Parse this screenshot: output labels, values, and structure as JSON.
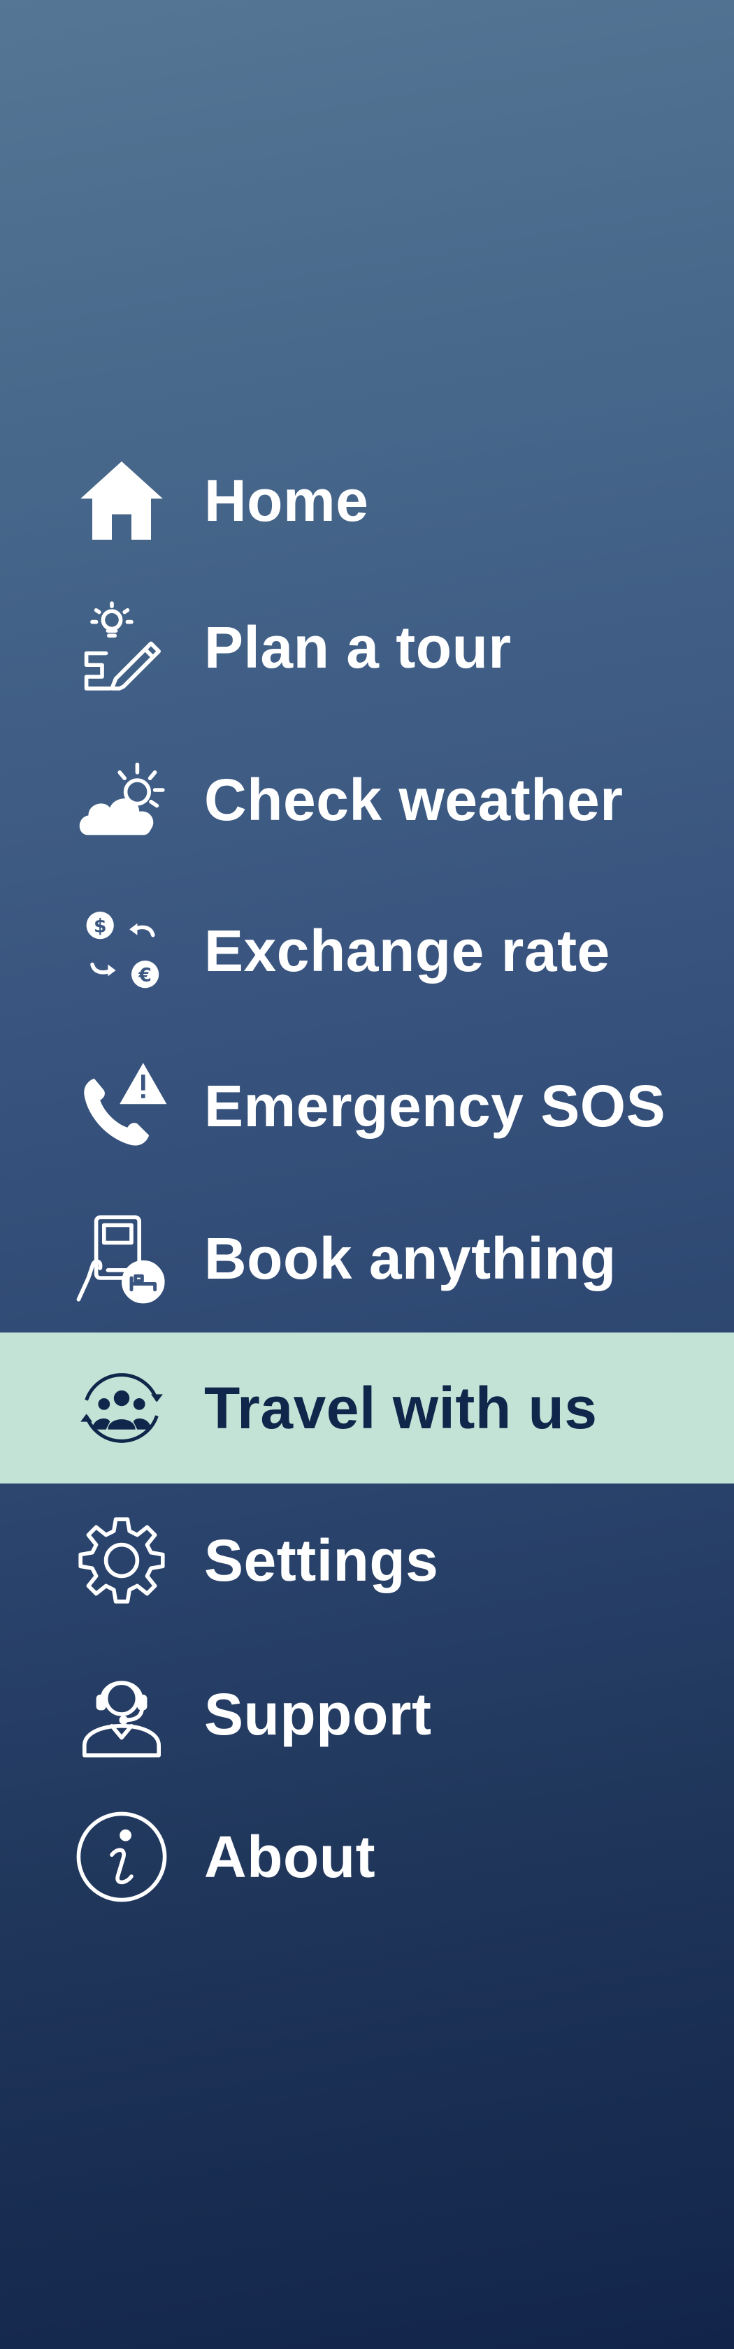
{
  "menu": {
    "items": [
      {
        "label": "Home",
        "icon": "home-icon",
        "active": false
      },
      {
        "label": "Plan a tour",
        "icon": "plan-tour-icon",
        "active": false
      },
      {
        "label": "Check weather",
        "icon": "weather-icon",
        "active": false
      },
      {
        "label": "Exchange rate",
        "icon": "currency-exchange-icon",
        "active": false
      },
      {
        "label": "Emergency SOS",
        "icon": "emergency-phone-icon",
        "active": false
      },
      {
        "label": "Book anything",
        "icon": "booking-icon",
        "active": false
      },
      {
        "label": "Travel with us",
        "icon": "group-travel-icon",
        "active": true
      },
      {
        "label": "Settings",
        "icon": "gear-icon",
        "active": false
      },
      {
        "label": "Support",
        "icon": "support-agent-icon",
        "active": false
      },
      {
        "label": "About",
        "icon": "info-icon",
        "active": false
      }
    ]
  },
  "colors": {
    "background_top": "#557694",
    "background_bottom": "#12244a",
    "active_highlight": "#c4e3d7",
    "active_text": "#10264a",
    "text": "#ffffff"
  }
}
